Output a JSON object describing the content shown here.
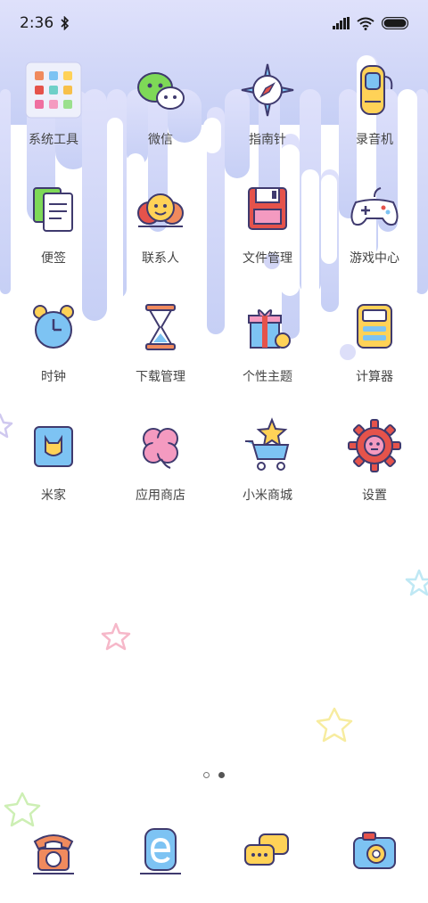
{
  "status_bar": {
    "time": "2:36"
  },
  "home_page": {
    "apps": [
      {
        "id": "system-tools",
        "label": "系统工具",
        "icon": "folder-icon"
      },
      {
        "id": "wechat",
        "label": "微信",
        "icon": "wechat-icon"
      },
      {
        "id": "compass",
        "label": "指南针",
        "icon": "compass-icon"
      },
      {
        "id": "recorder",
        "label": "录音机",
        "icon": "recorder-icon"
      },
      {
        "id": "notes",
        "label": "便签",
        "icon": "notes-icon"
      },
      {
        "id": "contacts",
        "label": "联系人",
        "icon": "contacts-icon"
      },
      {
        "id": "file-manager",
        "label": "文件管理",
        "icon": "file-manager-icon"
      },
      {
        "id": "game-center",
        "label": "游戏中心",
        "icon": "gamepad-icon"
      },
      {
        "id": "clock",
        "label": "时钟",
        "icon": "alarm-clock-icon"
      },
      {
        "id": "downloads",
        "label": "下载管理",
        "icon": "hourglass-icon"
      },
      {
        "id": "themes",
        "label": "个性主题",
        "icon": "gift-icon"
      },
      {
        "id": "calculator",
        "label": "计算器",
        "icon": "calculator-icon"
      },
      {
        "id": "mi-home",
        "label": "米家",
        "icon": "mi-home-icon"
      },
      {
        "id": "app-store",
        "label": "应用商店",
        "icon": "clover-icon"
      },
      {
        "id": "mi-store",
        "label": "小米商城",
        "icon": "shopping-cart-icon"
      },
      {
        "id": "settings",
        "label": "设置",
        "icon": "gear-icon"
      }
    ]
  },
  "page_indicator": {
    "count": 2,
    "active_index": 1
  },
  "dock": {
    "apps": [
      {
        "id": "phone",
        "icon": "phone-icon"
      },
      {
        "id": "browser",
        "icon": "browser-icon"
      },
      {
        "id": "messages",
        "icon": "messages-icon"
      },
      {
        "id": "camera",
        "icon": "camera-icon"
      }
    ]
  },
  "colors": {
    "wallpaper_top": "#d7dcfb",
    "wallpaper_drip": "#cbd3f6",
    "label": "#444444",
    "outline": "#3f3a6e"
  }
}
